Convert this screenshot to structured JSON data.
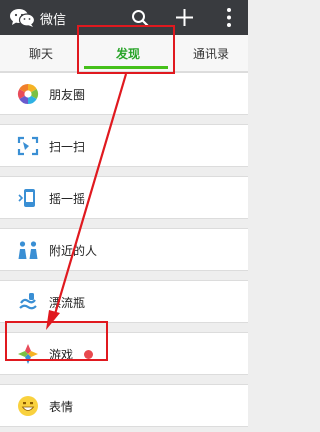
{
  "appbar": {
    "title": "微信",
    "icons": [
      "wechat-logo-icon",
      "search-icon",
      "plus-icon",
      "more-vertical-icon"
    ]
  },
  "tabs": [
    {
      "label": "聊天",
      "active": false
    },
    {
      "label": "发现",
      "active": true
    },
    {
      "label": "通讯录",
      "active": false
    }
  ],
  "items": [
    {
      "label": "朋友圈",
      "icon": "moments-icon"
    },
    {
      "label": "扫一扫",
      "icon": "scan-icon"
    },
    {
      "label": "摇一摇",
      "icon": "shake-icon"
    },
    {
      "label": "附近的人",
      "icon": "people-nearby-icon"
    },
    {
      "label": "漂流瓶",
      "icon": "drift-bottle-icon"
    },
    {
      "label": "游戏",
      "icon": "games-icon",
      "badge": "red-dot"
    },
    {
      "label": "表情",
      "icon": "stickers-icon"
    }
  ],
  "colors": {
    "appbar": "#393b3f",
    "active_tab": "#2aa52a",
    "tab_underline": "#45c01a",
    "annotation": "#e0191f",
    "badge": "#e8494e"
  }
}
